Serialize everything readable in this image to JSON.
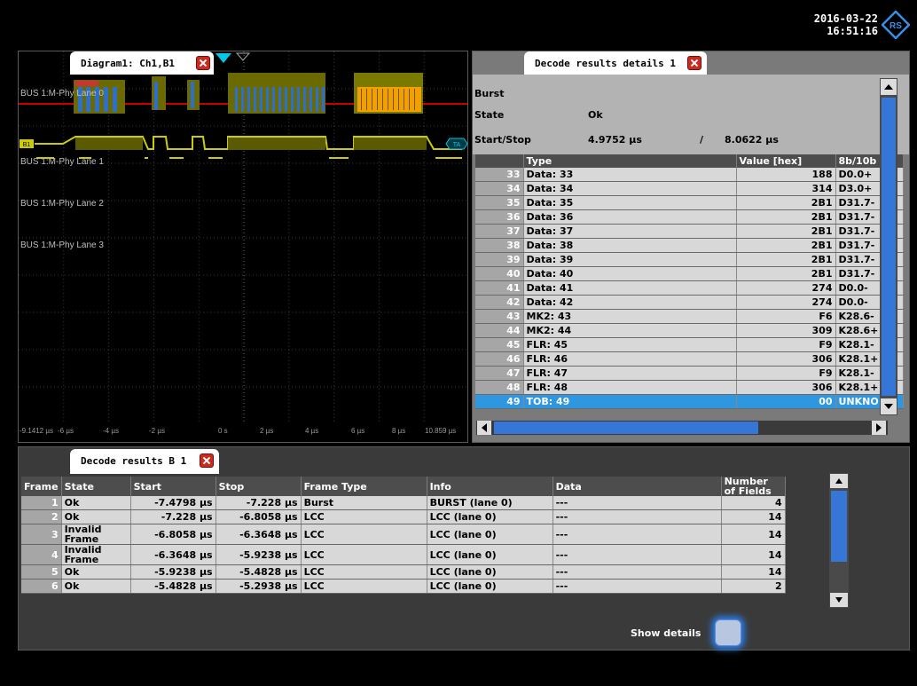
{
  "header": {
    "date": "2016-03-22",
    "time": "16:51:16",
    "logo_icon": "rohde-schwarz-logo-icon",
    "logo_text": "RS"
  },
  "diagram": {
    "tab_label": "Diagram1: Ch1,B1",
    "lanes": [
      "BUS 1:M-Phy Lane 0",
      "BUS 1:M-Phy Lane 1",
      "BUS 1:M-Phy Lane 2",
      "BUS 1:M-Phy Lane 3"
    ],
    "bus_marker": "B1",
    "trigger_marker": "TA",
    "x_ticks": [
      "-9.1412 µs",
      "-6 µs",
      "-4 µs",
      "-2 µs",
      "0 s",
      "2 µs",
      "4 µs",
      "6 µs",
      "8 µs",
      "10.859 µs"
    ],
    "colors": {
      "lane0": "#c80000",
      "lane1": "#cccc00",
      "frame": "#7a7a00",
      "data": "#f0a000",
      "trigger": "#00c8e6"
    }
  },
  "details": {
    "tab_label": "Decode results details 1",
    "burst_label": "Burst",
    "state_label": "State",
    "state_value": "Ok",
    "startstop_label": "Start/Stop",
    "start_value": "4.9752 µs",
    "separator": "/",
    "stop_value": "8.0622 µs",
    "columns": [
      "",
      "Type",
      "Value [hex]",
      "8b/10b"
    ],
    "rows": [
      [
        "33",
        "Data: 33",
        "188",
        "D0.0+"
      ],
      [
        "34",
        "Data: 34",
        "314",
        "D3.0+"
      ],
      [
        "35",
        "Data: 35",
        "2B1",
        "D31.7-"
      ],
      [
        "36",
        "Data: 36",
        "2B1",
        "D31.7-"
      ],
      [
        "37",
        "Data: 37",
        "2B1",
        "D31.7-"
      ],
      [
        "38",
        "Data: 38",
        "2B1",
        "D31.7-"
      ],
      [
        "39",
        "Data: 39",
        "2B1",
        "D31.7-"
      ],
      [
        "40",
        "Data: 40",
        "2B1",
        "D31.7-"
      ],
      [
        "41",
        "Data: 41",
        "274",
        "D0.0-"
      ],
      [
        "42",
        "Data: 42",
        "274",
        "D0.0-"
      ],
      [
        "43",
        "MK2: 43",
        "F6",
        "K28.6-"
      ],
      [
        "44",
        "MK2: 44",
        "309",
        "K28.6+"
      ],
      [
        "45",
        "FLR: 45",
        "F9",
        "K28.1-"
      ],
      [
        "46",
        "FLR: 46",
        "306",
        "K28.1+"
      ],
      [
        "47",
        "FLR: 47",
        "F9",
        "K28.1-"
      ],
      [
        "48",
        "FLR: 48",
        "306",
        "K28.1+"
      ],
      [
        "49",
        "TOB: 49",
        "00",
        "UNKNO"
      ]
    ],
    "selected_row": 16
  },
  "results": {
    "tab_label": "Decode results B 1",
    "columns": [
      "Frame",
      "State",
      "Start",
      "Stop",
      "Frame Type",
      "Info",
      "Data",
      "Number of Fields"
    ],
    "rows": [
      [
        "1",
        "Ok",
        "-7.4798 µs",
        "-7.228 µs",
        "Burst",
        "BURST (lane 0)",
        "---",
        "4"
      ],
      [
        "2",
        "Ok",
        "-7.228 µs",
        "-6.8058 µs",
        "LCC",
        "LCC (lane 0)",
        "---",
        "14"
      ],
      [
        "3",
        "Invalid Frame",
        "-6.8058 µs",
        "-6.3648 µs",
        "LCC",
        "LCC (lane 0)",
        "---",
        "14"
      ],
      [
        "4",
        "Invalid Frame",
        "-6.3648 µs",
        "-5.9238 µs",
        "LCC",
        "LCC (lane 0)",
        "---",
        "14"
      ],
      [
        "5",
        "Ok",
        "-5.9238 µs",
        "-5.4828 µs",
        "LCC",
        "LCC (lane 0)",
        "---",
        "14"
      ],
      [
        "6",
        "Ok",
        "-5.4828 µs",
        "-5.2938 µs",
        "LCC",
        "LCC (lane 0)",
        "---",
        "2"
      ]
    ],
    "show_details_label": "Show details"
  }
}
